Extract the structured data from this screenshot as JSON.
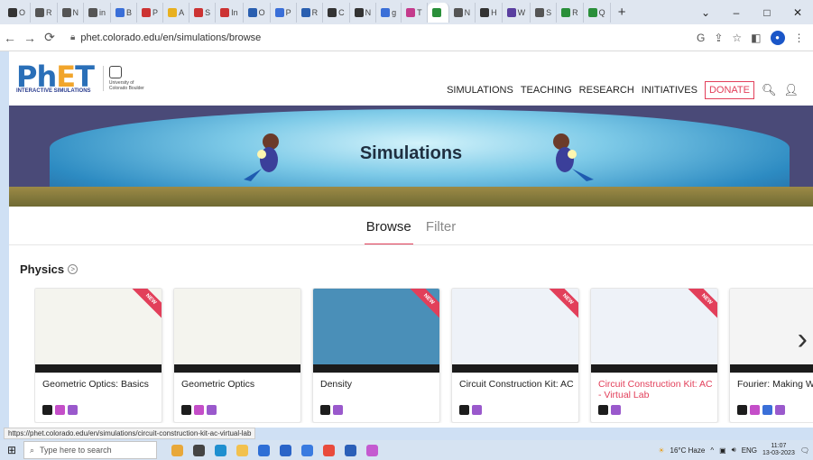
{
  "browser": {
    "tabs": [
      {
        "label": "O",
        "color": "#333333"
      },
      {
        "label": "R",
        "color": "#555555"
      },
      {
        "label": "N",
        "color": "#555555"
      },
      {
        "label": "in",
        "color": "#555555"
      },
      {
        "label": "B",
        "color": "#3a6fd8"
      },
      {
        "label": "P",
        "color": "#cc3333"
      },
      {
        "label": "A",
        "color": "#e8b020"
      },
      {
        "label": "S",
        "color": "#cc3333"
      },
      {
        "label": "In",
        "color": "#cc3333"
      },
      {
        "label": "O",
        "color": "#2a5fb0"
      },
      {
        "label": "P",
        "color": "#3a6fd8"
      },
      {
        "label": "R",
        "color": "#2a5fb0"
      },
      {
        "label": "C",
        "color": "#333333"
      },
      {
        "label": "N",
        "color": "#333333"
      },
      {
        "label": "g",
        "color": "#3a6fd8"
      },
      {
        "label": "T",
        "color": "#c43b8c"
      },
      {
        "label": "",
        "color": "#2a8f3a"
      },
      {
        "label": "N",
        "color": "#555555"
      },
      {
        "label": "H",
        "color": "#333333"
      },
      {
        "label": "W",
        "color": "#5a3fa0"
      },
      {
        "label": "S",
        "color": "#555555"
      },
      {
        "label": "R",
        "color": "#2a8f3a"
      },
      {
        "label": "Q",
        "color": "#2a8f3a"
      }
    ],
    "active_tab_index": 16,
    "new_tab": "+",
    "url": "phet.colorado.edu/en/simulations/browse",
    "window_controls": {
      "minimize": "–",
      "maximize": "□",
      "close": "✕",
      "chevron": "⌄"
    }
  },
  "site": {
    "logo_text": "PhET",
    "logo_sub": "INTERACTIVE SIMULATIONS",
    "university": "University of Colorado Boulder",
    "nav": [
      "SIMULATIONS",
      "TEACHING",
      "RESEARCH",
      "INITIATIVES"
    ],
    "donate": "DONATE",
    "banner_title": "Simulations",
    "browse_tabs": [
      "Browse",
      "Filter"
    ],
    "active_browse_tab": 0,
    "section_title": "Physics",
    "ribbon": "NEW",
    "cards": [
      {
        "title": "Geometric Optics: Basics",
        "new": true,
        "highlight": false,
        "badges": [
          "html",
          "pink",
          "violet"
        ]
      },
      {
        "title": "Geometric Optics",
        "new": false,
        "highlight": false,
        "badges": [
          "html",
          "pink",
          "violet"
        ]
      },
      {
        "title": "Density",
        "new": true,
        "highlight": false,
        "badges": [
          "html",
          "violet"
        ]
      },
      {
        "title": "Circuit Construction Kit: AC",
        "new": true,
        "highlight": false,
        "badges": [
          "html",
          "violet"
        ]
      },
      {
        "title": "Circuit Construction Kit: AC - Virtual Lab",
        "new": true,
        "highlight": true,
        "badges": [
          "html",
          "violet"
        ]
      },
      {
        "title": "Fourier: Making Waves",
        "new": false,
        "highlight": false,
        "badges": [
          "html",
          "pink",
          "blue",
          "violet"
        ]
      }
    ]
  },
  "status_url": "https://phet.colorado.edu/en/simulations/circuit-construction-kit-ac-virtual-lab",
  "taskbar": {
    "search_placeholder": "Type here to search",
    "weather": "16°C Haze",
    "lang": "ENG",
    "time": "11:07",
    "date": "13-03-2023"
  },
  "colors": {
    "accent": "#e23f5a",
    "brand_blue": "#2a6fb8",
    "brand_orange": "#f1a52b"
  }
}
